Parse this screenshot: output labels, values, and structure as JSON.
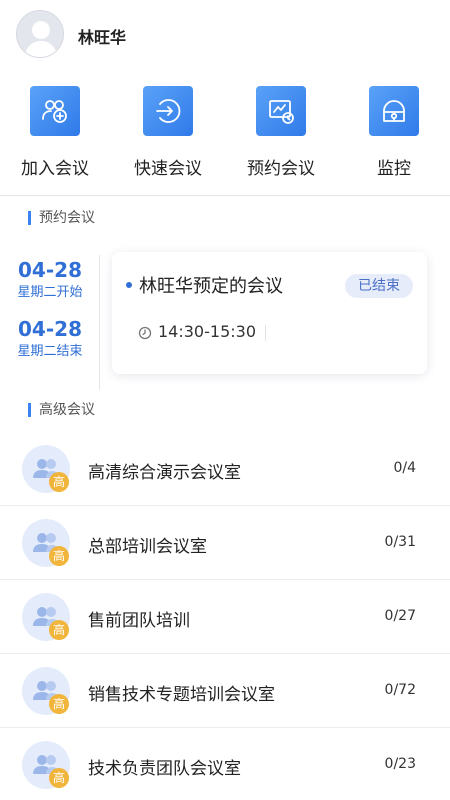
{
  "user": {
    "name": "林旺华"
  },
  "actions": [
    {
      "label": "加入会议",
      "icon": "join-meeting-icon"
    },
    {
      "label": "快速会议",
      "icon": "quick-meeting-icon"
    },
    {
      "label": "预约会议",
      "icon": "schedule-meeting-icon"
    },
    {
      "label": "监控",
      "icon": "monitor-icon"
    }
  ],
  "scheduled": {
    "section_title": "预约会议",
    "start_date": "04-28",
    "start_label": "星期二开始",
    "end_date": "04-28",
    "end_label": "星期二结束",
    "meeting_title": "林旺华预定的会议",
    "status": "已结束",
    "time": "14:30-15:30"
  },
  "advanced": {
    "section_title": "高级会议",
    "badge": "高",
    "rooms": [
      {
        "name": "高清综合演示会议室",
        "count": "0/4"
      },
      {
        "name": "总部培训会议室",
        "count": "0/31"
      },
      {
        "name": "售前团队培训",
        "count": "0/27"
      },
      {
        "name": "销售技术专题培训会议室",
        "count": "0/72"
      },
      {
        "name": "技术负责团队会议室",
        "count": "0/23"
      }
    ]
  },
  "colors": {
    "accent": "#2f6fd6",
    "tile": "#3b82f6",
    "badge": "#f2b53b",
    "status_bg": "#e7ecfa"
  }
}
